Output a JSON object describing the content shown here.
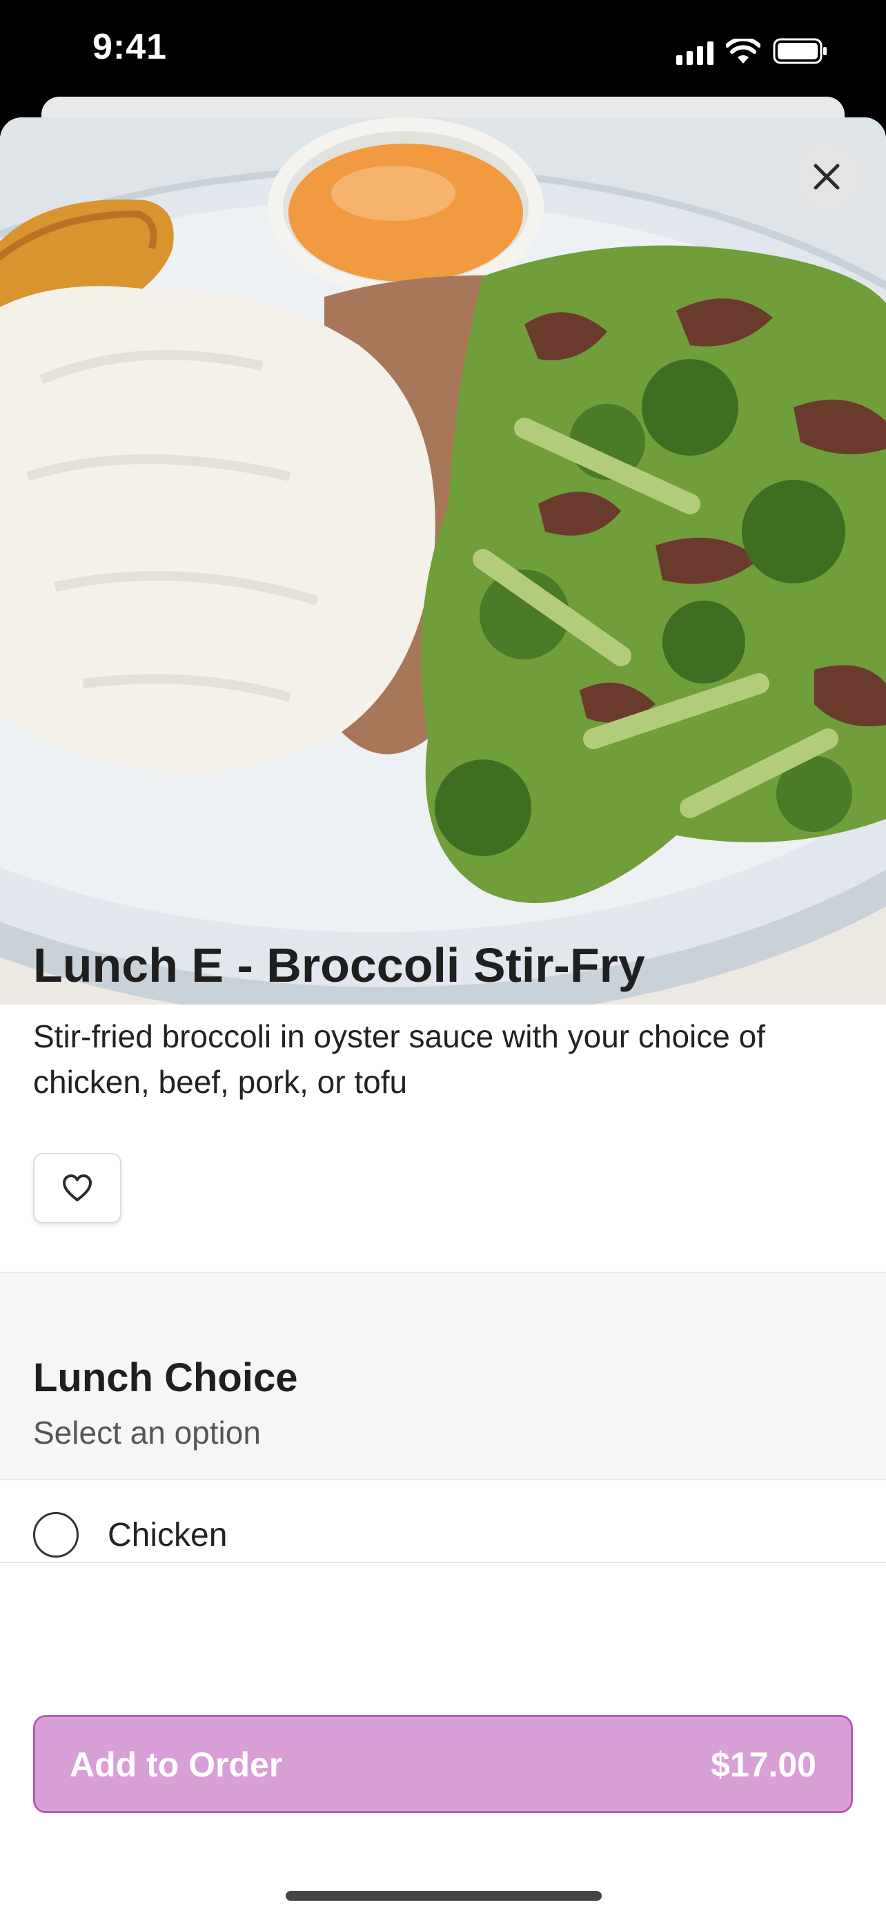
{
  "status_bar": {
    "time": "9:41",
    "icons": [
      "cellular-signal-icon",
      "wifi-icon",
      "battery-icon"
    ]
  },
  "item": {
    "image_icon": "food-photo",
    "close_icon": "close-icon",
    "title": "Lunch E - Broccoli Stir-Fry",
    "description": "Stir-fried broccoli in oyster sauce with your choice of chicken, beef, pork, or tofu",
    "favorite_icon": "heart-icon"
  },
  "lunch_choice": {
    "title": "Lunch Choice",
    "subtitle": "Select an option",
    "options": [
      {
        "label": "Chicken",
        "selected": false
      }
    ]
  },
  "footer": {
    "add_label": "Add to Order",
    "price": "$17.00"
  },
  "colors": {
    "accent": "#d99fd7",
    "accent_border": "#bb5bb9"
  }
}
